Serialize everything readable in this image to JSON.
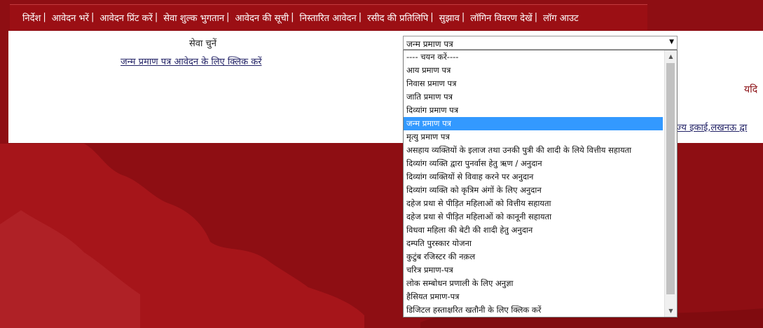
{
  "nav": {
    "items": [
      {
        "label": "निर्देश"
      },
      {
        "label": "आवेदन भरें"
      },
      {
        "label": "आवेदन प्रिंट करें"
      },
      {
        "label": "सेवा शुल्क भुगतान"
      },
      {
        "label": "आवेदन की सूची"
      },
      {
        "label": "निस्तारित आवेदन"
      },
      {
        "label": "रसीद की प्रतिलिपि"
      },
      {
        "label": "सुझाव"
      },
      {
        "label": "लॉगिन विवरण देखें"
      },
      {
        "label": "लॉग आउट"
      }
    ],
    "separator": "|"
  },
  "form": {
    "service_label": "सेवा चुनें",
    "apply_link": "जन्म प्रमाण पत्र आवेदन के लिए क्लिक करें",
    "selected_value": "जन्म प्रमाण पत्र"
  },
  "right": {
    "text": "यदि",
    "link": "ज्य इकाई,लखनऊ द्वा"
  },
  "dropdown": {
    "options": [
      "---- चयन करें----",
      "आय प्रमाण पत्र",
      "निवास प्रमाण पत्र",
      "जाति प्रमाण पत्र",
      "दिव्यांग प्रमाण पत्र",
      "जन्म प्रमाण पत्र",
      "मृत्यु प्रमाण पत्र",
      "असहाय व्यक्तियों के इलाज तथा उनकी पुत्री की शादी के लिये वित्तीय सहायता",
      "दिव्यांग व्यक्ति द्वारा पुनर्वास हेतु ऋण / अनुदान",
      "दिव्यांग व्यक्तियों से विवाह करने पर अनुदान",
      "दिव्यांग व्यक्ति को कृत्रिम अंगों के लिए अनुदान",
      "दहेज प्रथा से पीड़ित महिलाओं को वित्तीय सहायता",
      "दहेज प्रथा से पीड़ित महिलाओं को कानूनी सहायता",
      "विधवा महिला की बेटी की शादी हेतु अनुदान",
      "दम्पति पुरस्कार योजना",
      "कुटुंब रजिस्टर की नक़ल",
      "चरित्र प्रमाण-पत्र",
      "लोक सम्बोधन प्रणाली के लिए अनुज्ञा",
      "हैसियत प्रमाण-पत्र",
      "डिजिटल हस्ताक्षरित खतौनी के लिए क्लिक करें"
    ],
    "selected_index": 5
  },
  "icons": {
    "select_arrow": "chevron-down-icon",
    "scroll_up": "scroll-up-icon",
    "scroll_down": "scroll-down-icon"
  },
  "colors": {
    "nav_bg": "#9b0f14",
    "page_bg": "#8a0d12",
    "selected_bg": "#3399ff",
    "link": "#222266"
  }
}
